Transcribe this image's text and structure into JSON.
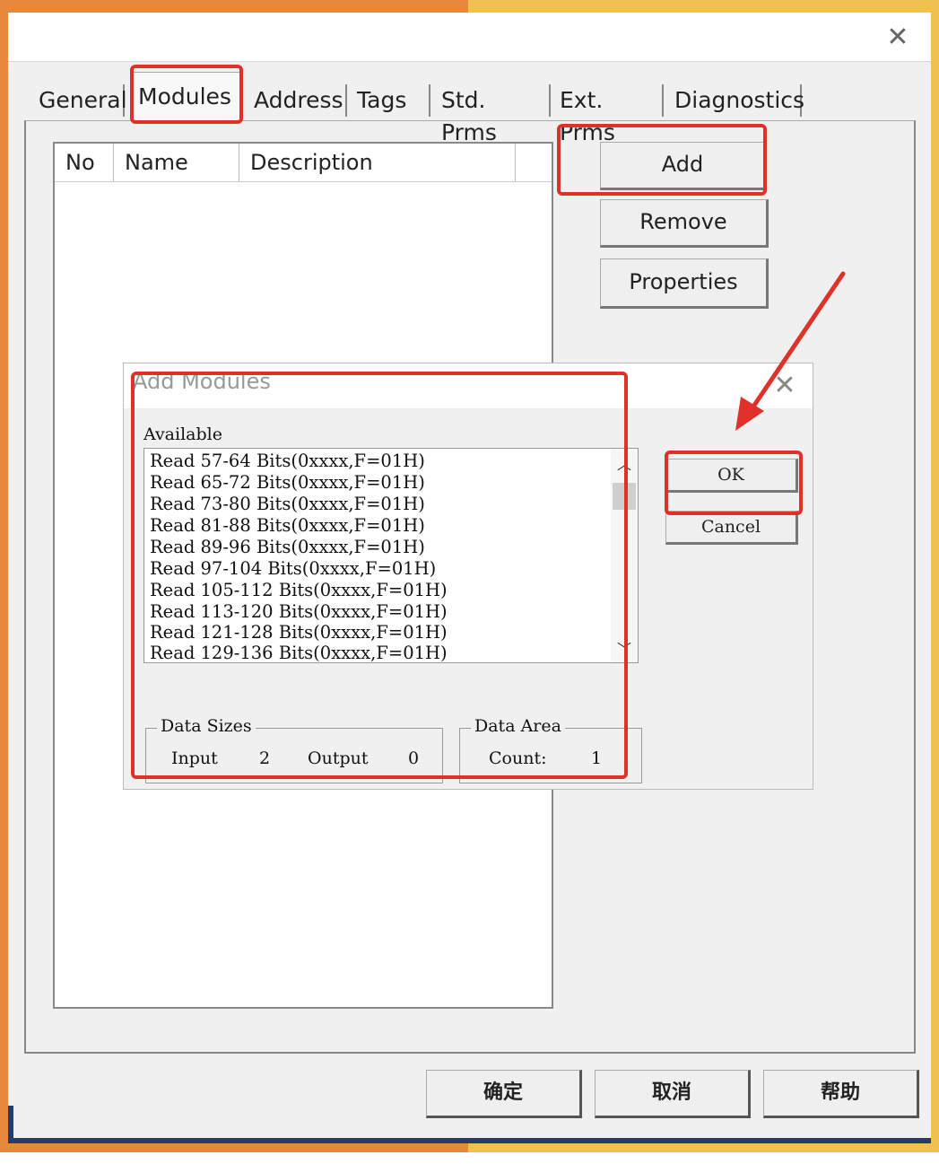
{
  "window": {
    "tabs": [
      {
        "label": "General"
      },
      {
        "label": "Modules"
      },
      {
        "label": "Address"
      },
      {
        "label": "Tags"
      },
      {
        "label": "Std. Prms"
      },
      {
        "label": "Ext. Prms"
      },
      {
        "label": "Diagnostics"
      }
    ],
    "active_tab": "Modules",
    "list_columns": [
      "No",
      "Name",
      "Description"
    ],
    "side_buttons": {
      "add": "Add",
      "remove": "Remove",
      "properties": "Properties"
    },
    "bottom_buttons": {
      "ok": "确定",
      "cancel": "取消",
      "help": "帮助"
    }
  },
  "add_modules_dialog": {
    "title": "Add Modules",
    "available_label": "Available",
    "available_items": [
      "Read 57-64 Bits(0xxxx,F=01H)",
      "Read 65-72 Bits(0xxxx,F=01H)",
      "Read 73-80 Bits(0xxxx,F=01H)",
      "Read 81-88 Bits(0xxxx,F=01H)",
      "Read 89-96 Bits(0xxxx,F=01H)",
      "Read 97-104 Bits(0xxxx,F=01H)",
      "Read 105-112 Bits(0xxxx,F=01H)",
      "Read 113-120 Bits(0xxxx,F=01H)",
      "Read 121-128 Bits(0xxxx,F=01H)",
      "Read 129-136 Bits(0xxxx,F=01H)"
    ],
    "ok_label": "OK",
    "cancel_label": "Cancel",
    "data_sizes": {
      "label": "Data Sizes",
      "input_label": "Input",
      "input_value": "2",
      "output_label": "Output",
      "output_value": "0"
    },
    "data_area": {
      "label": "Data Area",
      "count_label": "Count:",
      "count_value": "1"
    }
  },
  "colors": {
    "highlight": "#e0302a",
    "frame_left": "#e8883c",
    "frame_right": "#f0c050",
    "frame_navy": "#2a3a66"
  }
}
